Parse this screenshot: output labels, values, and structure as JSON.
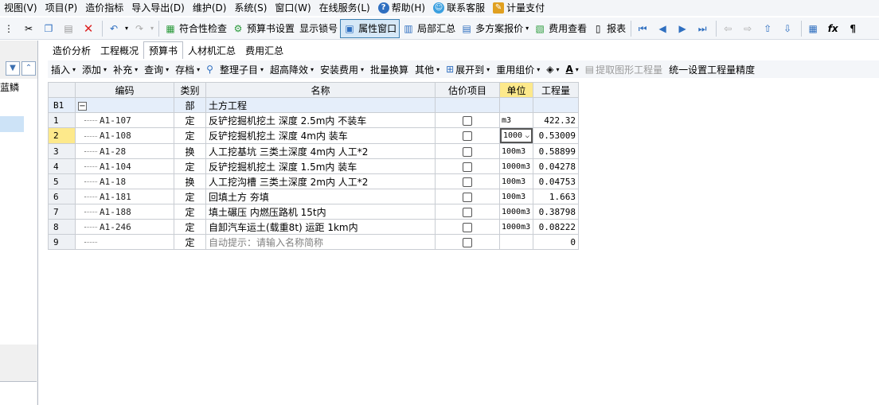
{
  "menu": {
    "items": [
      "视图(V)",
      "项目(P)",
      "造价指标",
      "导入导出(D)",
      "维护(D)",
      "系统(S)",
      "窗口(W)",
      "在线服务(L)",
      "帮助(H)",
      "联系客服",
      "计量支付"
    ]
  },
  "toolbar": {
    "compliance_check": "符合性检查",
    "budget_settings": "预算书设置",
    "show_lock": "显示锁号",
    "property_window": "属性窗口",
    "partial_summary": "局部汇总",
    "multi_quote": "多方案报价",
    "fee_view": "费用查看",
    "report": "报表"
  },
  "tabs": [
    "造价分析",
    "工程概况",
    "预算书",
    "人材机汇总",
    "费用汇总"
  ],
  "subtoolbar": {
    "insert": "插入",
    "add": "添加",
    "supplement": "补充",
    "query": "查询",
    "archive": "存档",
    "organize": "整理子目",
    "super_high": "超高降效",
    "install_fee": "安装费用",
    "batch_convert": "批量换算",
    "other": "其他",
    "expand_to": "展开到",
    "reuse_group": "重用组价",
    "extract_qty": "提取图形工程量",
    "unify_precision": "统一设置工程量精度"
  },
  "left_tree": {
    "item1": "蓝鳞"
  },
  "grid": {
    "headers": {
      "code": "编码",
      "category": "类别",
      "name": "名称",
      "estimate": "估价项目",
      "unit": "单位",
      "qty": "工程量"
    },
    "section": {
      "rn": "B1",
      "category": "部",
      "name": "土方工程"
    },
    "rows": [
      {
        "rn": "1",
        "code": "A1-107",
        "cat": "定",
        "name": "反铲挖掘机挖土 深度 2.5m内 不装车",
        "unit": "m3",
        "qty": "422.32"
      },
      {
        "rn": "2",
        "code": "A1-108",
        "cat": "定",
        "name": "反铲挖掘机挖土 深度 4m内 装车",
        "unit": "1000",
        "qty": "0.53009"
      },
      {
        "rn": "3",
        "code": "A1-28",
        "cat": "换",
        "name": "人工挖基坑 三类土深度 4m内  人工*2",
        "unit": "100m3",
        "qty": "0.58899"
      },
      {
        "rn": "4",
        "code": "A1-104",
        "cat": "定",
        "name": "反铲挖掘机挖土 深度 1.5m内 装车",
        "unit": "1000m3",
        "qty": "0.04278"
      },
      {
        "rn": "5",
        "code": "A1-18",
        "cat": "换",
        "name": "人工挖沟槽 三类土深度 2m内  人工*2",
        "unit": "100m3",
        "qty": "0.04753"
      },
      {
        "rn": "6",
        "code": "A1-181",
        "cat": "定",
        "name": "回填土方 夯填",
        "unit": "100m3",
        "qty": "1.663"
      },
      {
        "rn": "7",
        "code": "A1-188",
        "cat": "定",
        "name": "填土碾压 内燃压路机 15t内",
        "unit": "1000m3",
        "qty": "0.38798"
      },
      {
        "rn": "8",
        "code": "A1-246",
        "cat": "定",
        "name": "自卸汽车运土(载重8t) 运距 1km内",
        "unit": "1000m3",
        "qty": "0.08222"
      },
      {
        "rn": "9",
        "code": "",
        "cat": "定",
        "name": "自动提示：请输入名称简称",
        "unit": "",
        "qty": "0"
      }
    ]
  },
  "colors": {
    "selected_header": "#fde98b",
    "section_row": "#e5eefa",
    "accent": "#3c7fb1"
  }
}
